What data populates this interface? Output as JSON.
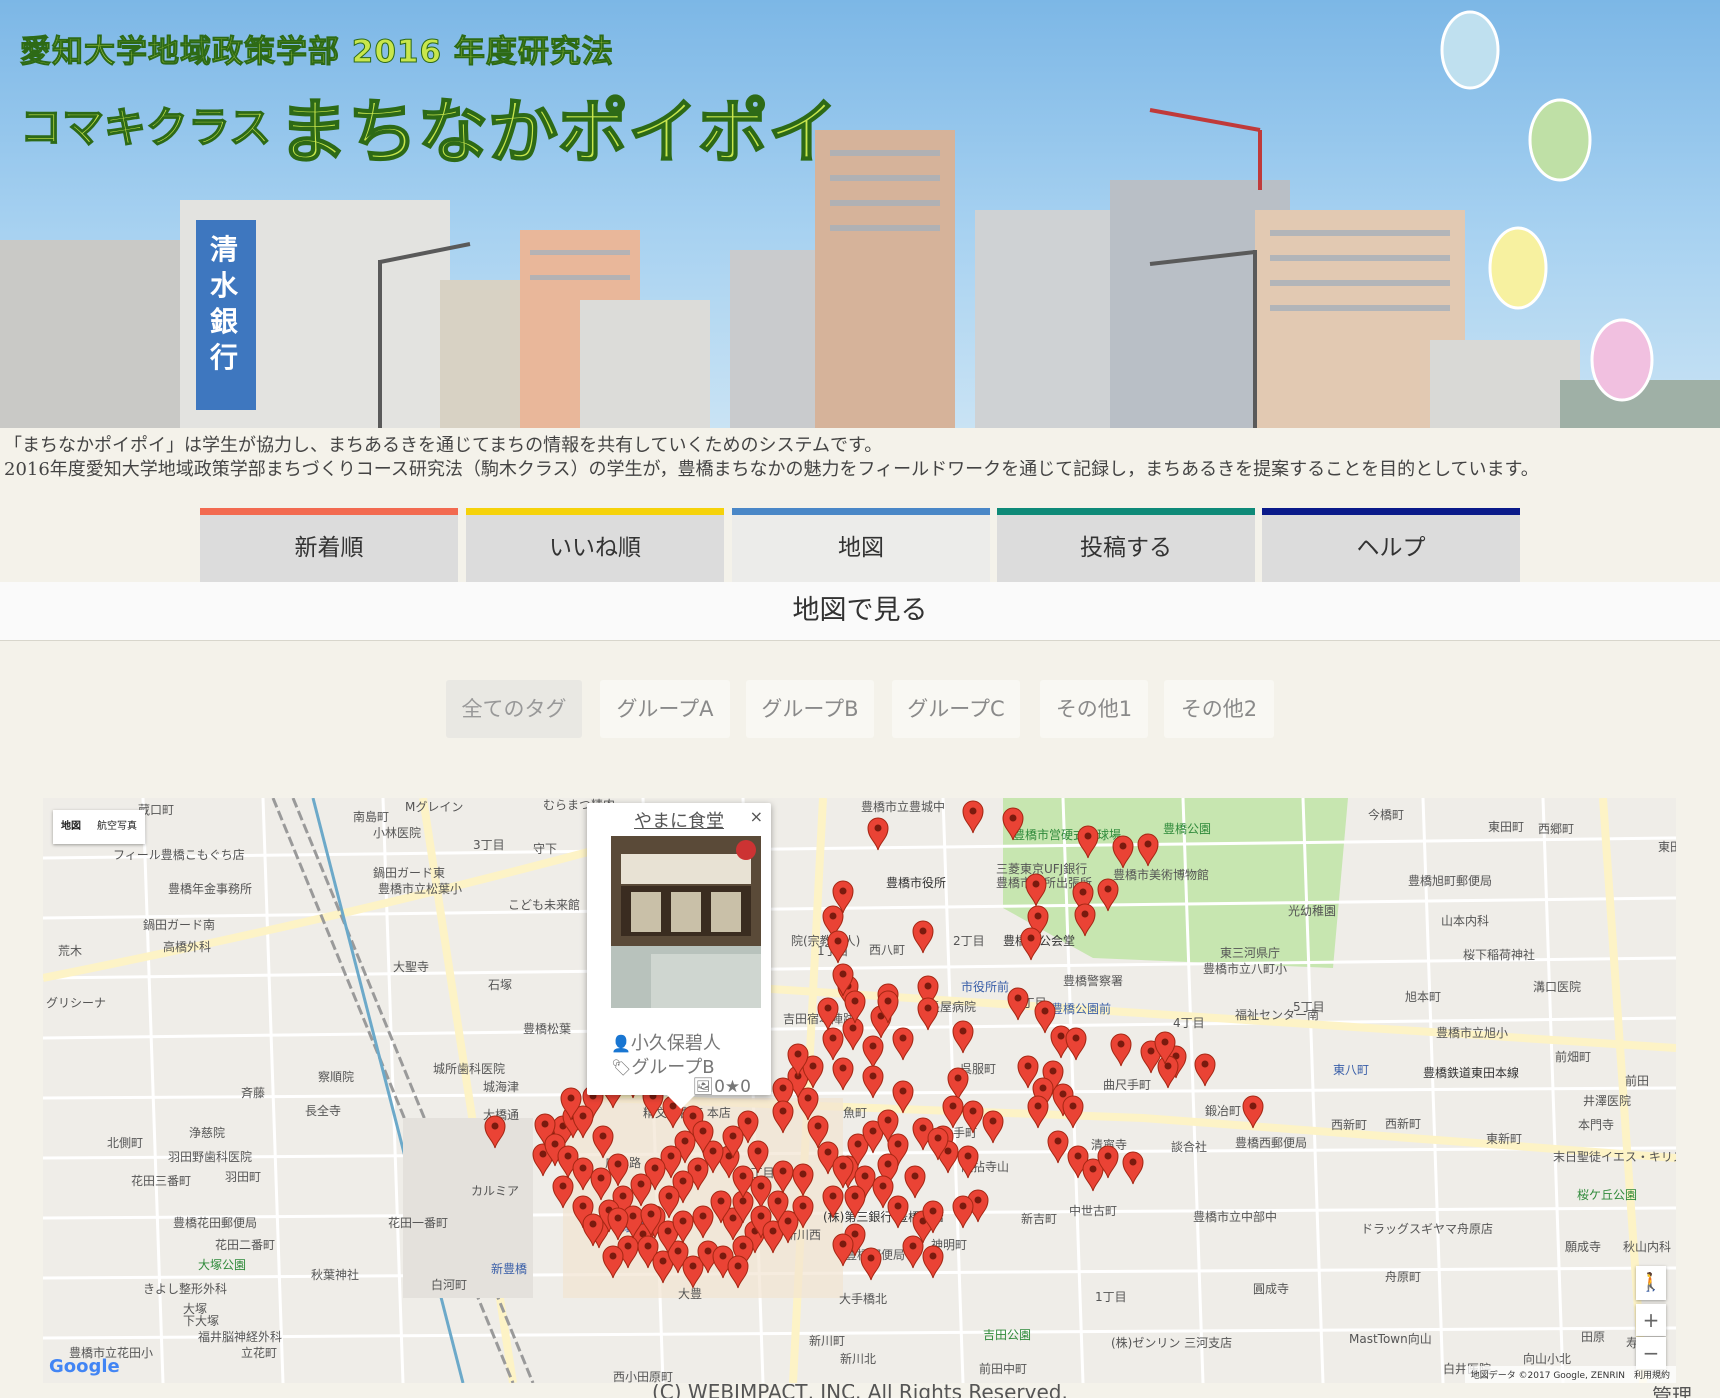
{
  "banner": {
    "line1": "愛知大学地域政策学部 2016 年度研究法",
    "line2": "コマキクラス",
    "line3": "まちなかポイポイ",
    "sign": "清水銀行"
  },
  "intro": {
    "line1": "「まちなかポイポイ」は学生が協力し、まちあるきを通じてまちの情報を共有していくためのシステムです。",
    "line2": "2016年度愛知大学地域政策学部まちづくりコース研究法（駒木クラス）の学生が，豊橋まちなかの魅力をフィールドワークを通じて記録し，まちあるきを提案することを目的としています。"
  },
  "nav": {
    "tabs": [
      {
        "label": "新着順",
        "color": "#f26a50"
      },
      {
        "label": "いいね順",
        "color": "#f5d20a"
      },
      {
        "label": "地図",
        "color": "#4a87c7"
      },
      {
        "label": "投稿する",
        "color": "#0e8a78"
      },
      {
        "label": "ヘルプ",
        "color": "#0a1a8a"
      }
    ],
    "active": "地図"
  },
  "section": {
    "title": "地図で見る"
  },
  "filters": {
    "tags": [
      "全てのタグ",
      "グループA",
      "グループB",
      "グループC",
      "その他1",
      "その他2"
    ],
    "active": "全てのタグ"
  },
  "map": {
    "type_buttons": [
      "地図",
      "航空写真"
    ],
    "labels": [
      "蔵口町",
      "Mグレイン",
      "南島町",
      "小林医院",
      "むらまつ精肉",
      "豊橋市立豊城中",
      "今橋町",
      "東田町",
      "西郷町",
      "東田",
      "フィール豊橋こもぐち店",
      "3丁目",
      "守下",
      "鍋田ガード東",
      "豊橋年金事務所",
      "豊橋市立松葉小",
      "こども未来館",
      "豊橋市役所",
      "三菱東京UFJ銀行",
      "豊橋市役所出張所",
      "豊橋市美術博物館",
      "豊橋公園",
      "豊橋市営硬式庭球場",
      "豊橋旭町郵便局",
      "光幼稚園",
      "山本内科",
      "鍋田ガード南",
      "院(宗教法人)",
      "2丁目",
      "豊橋市公会堂",
      "東三河県庁",
      "豊橋市立八町小",
      "桜下稲荷神社",
      "高橋外科",
      "荒木",
      "大聖寺",
      "石塚",
      "西八町",
      "1丁目",
      "市役所前",
      "3丁目",
      "豊橋警察署",
      "豊橋公園前",
      "旭本町",
      "溝口医院",
      "グリシーナ",
      "豊橋松葉",
      "長屋病院",
      "吉田宿本陣跡",
      "4丁目",
      "5丁目",
      "福祉センター南",
      "豊橋市立旭小",
      "察順院",
      "城所歯科医院",
      "呉服町",
      "東八町",
      "豊橋鉄道東田本線",
      "前畑町",
      "斉藤",
      "長全寺",
      "城海津",
      "大橋通",
      "精文館書店 本店",
      "曲尺手町",
      "鍛冶町",
      "井澤医院",
      "前田",
      "北側町",
      "浄慈院",
      "羽田野歯科医院",
      "広小路",
      "魚町",
      "大手町",
      "清寧寺",
      "談合社",
      "豊橋西郵便局",
      "西新町",
      "西新町",
      "本門寺",
      "東新町",
      "花田三番町",
      "羽田町",
      "カルミア",
      "3丁目",
      "龍拈寺山",
      "末日聖徒イエス・キリスト教会 豊橋ワード",
      "花田一番町",
      "豊橋花田郵便局",
      "花田二番町",
      "(株)第三銀行 豊橋支店",
      "新吉町",
      "中世古町",
      "豊橋市立中部中",
      "ドラッグスギヤマ舟原店",
      "桜ケ丘公園",
      "大塚公園",
      "駅前",
      "新川西",
      "神明町",
      "豊橋郵便局",
      "願成寺",
      "秋山内科",
      "秋葉神社",
      "白河町",
      "新豊橋",
      "舟原町",
      "きよし整形外科",
      "1丁目",
      "圓成寺",
      "大塚",
      "大豊",
      "下大塚",
      "福井脳神経外科",
      "大手橋北",
      "立花町",
      "吉田公園",
      "(株)ゼンリン 三河支店",
      "MastTown向山",
      "豊橋市立花田小",
      "新川町",
      "新川北",
      "前田中町",
      "白井医院",
      "西小田原町",
      "向山小北",
      "田原",
      "寿"
    ],
    "google": "Google",
    "attribution": "地図データ ©2017 Google, ZENRIN　利用規約",
    "infowindow": {
      "title": "やまに食堂",
      "author": "小久保碧人",
      "group": "グループB",
      "photos": "0",
      "stars": "0"
    },
    "marker_color": "#ea4335"
  },
  "footer": {
    "copyright": "(C) WEBIMPACT, INC. All Rights Reserved.",
    "admin": "管理"
  }
}
